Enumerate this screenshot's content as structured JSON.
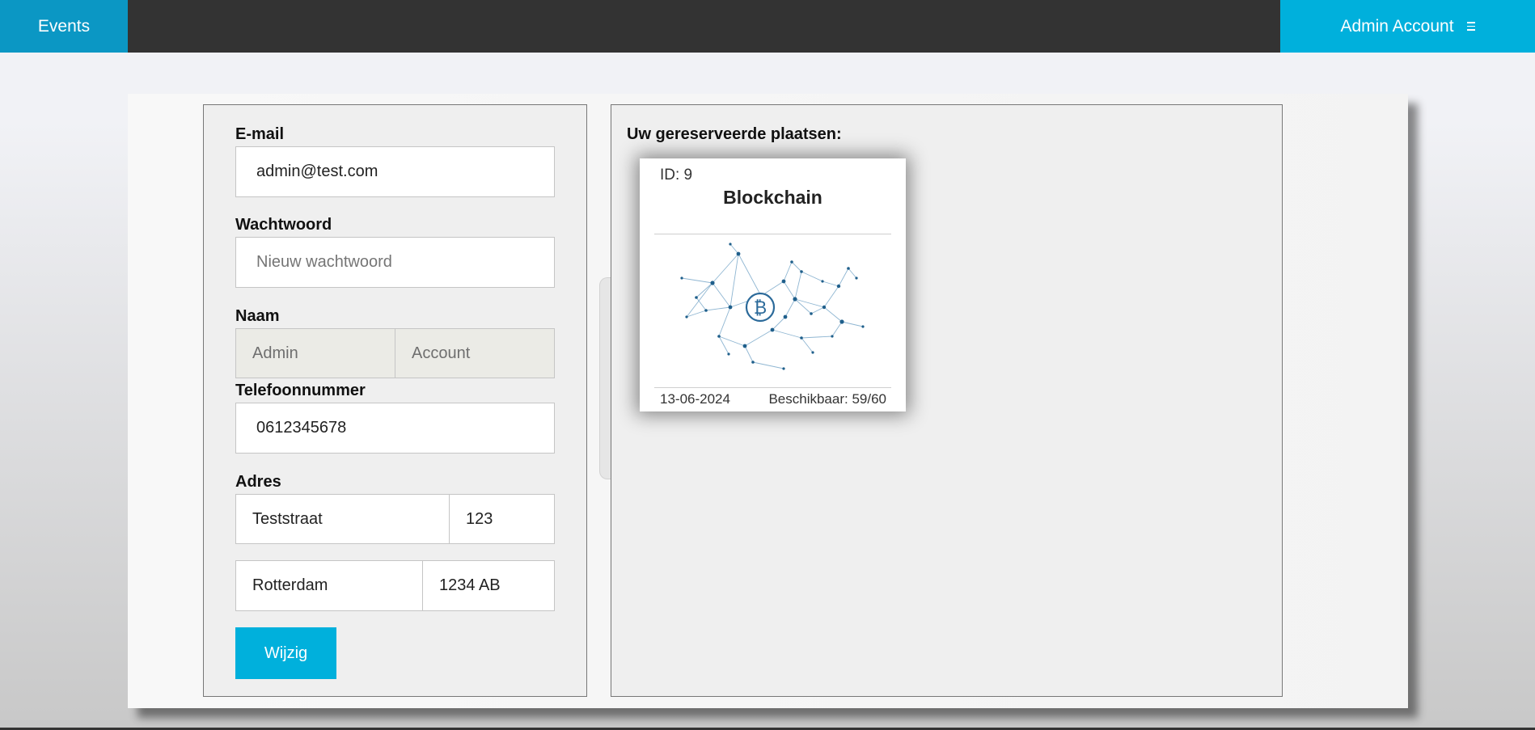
{
  "nav": {
    "events_label": "Events",
    "account_label": "Admin Account",
    "menu_icon": "hamburger-icon",
    "colors": {
      "navbar": "#333333",
      "events_tab": "#0b97c4",
      "account_tab": "#00b0dc"
    }
  },
  "profile_form": {
    "email": {
      "label": "E-mail",
      "value": "admin@test.com"
    },
    "password": {
      "label": "Wachtwoord",
      "placeholder": "Nieuw wachtwoord"
    },
    "name": {
      "label": "Naam",
      "first": "Admin",
      "last": "Account"
    },
    "phone": {
      "label": "Telefoonnummer",
      "value": "0612345678"
    },
    "address": {
      "label": "Adres",
      "street": "Teststraat",
      "number": "123",
      "city": "Rotterdam",
      "postcode": "1234 AB"
    },
    "submit_label": "Wijzig",
    "accent": "#00b0dc"
  },
  "reservations": {
    "title": "Uw gereserveerde plaatsen:",
    "events": [
      {
        "id_label": "ID: 9",
        "name": "Blockchain",
        "image_icon": "blockchain-network-icon",
        "date": "13-06-2024",
        "availability": "Beschikbaar: 59/60"
      }
    ]
  }
}
